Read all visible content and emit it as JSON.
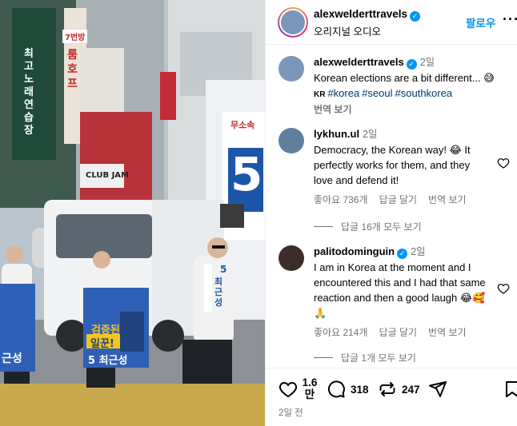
{
  "header": {
    "username": "alexwelderttravels",
    "subtitle": "오리지널 오디오",
    "follow_label": "팔로우",
    "more_icon": "···"
  },
  "caption": {
    "username": "alexwelderttravels",
    "time": "2일",
    "text": "Korean elections are a bit different... 😅",
    "location": "KR",
    "hashtags": [
      "#korea",
      "#seoul",
      "#southkorea"
    ],
    "translate": "번역 보기"
  },
  "comments": [
    {
      "username": "lykhun.ul",
      "time": "2일",
      "verified": false,
      "text": "Democracy, the Korean way! 😂 It perfectly works for them, and they love and defend it!",
      "likes": "좋아요 736개",
      "reply": "답글 달기",
      "translate": "번역 보기",
      "view_replies": "답글 16개 모두 보기"
    },
    {
      "username": "palitodominguin",
      "time": "2일",
      "verified": true,
      "text": "I am in Korea at the moment and I encountered this and I had that same reaction and then a good laugh 😂🥰🙏",
      "likes": "좋아요 214개",
      "reply": "답글 달기",
      "translate": "번역 보기",
      "view_replies": "답글 1개 모두 보기"
    }
  ],
  "actions": {
    "likes_count": "1.6만",
    "comments_count": "318",
    "reposts_count": "247",
    "date": "2일 전"
  },
  "video": {
    "signs": {
      "sign_top_left": "7번방",
      "sign_vertical_left": "최고노래연습장",
      "sign_vertical_mid": "룸호프",
      "sign_club": "CLUB JAM",
      "banner_number": "5",
      "banner_name": "무소속",
      "placard_left_name": "근성",
      "placard_mid_top": "검증된",
      "placard_mid_mid": "일꾼!",
      "placard_mid_name": "5 최근성",
      "shirt_num": "5",
      "shirt_text": "최근성"
    }
  },
  "colors": {
    "accent": "#0095f6",
    "link": "#00376b",
    "muted": "#737373"
  }
}
